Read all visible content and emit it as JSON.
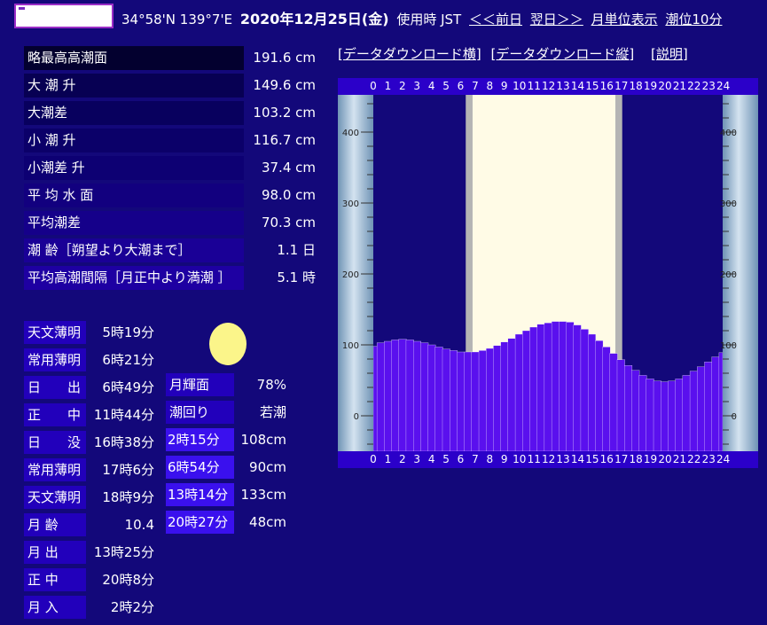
{
  "header": {
    "location": "34°58'N 139°7'E",
    "date": "2020年12月25日(金)",
    "timezone": "使用時 JST",
    "prev_day": "＜＜前日",
    "next_day": "翌日＞＞",
    "monthly": "月単位表示",
    "ten_min": "潮位10分"
  },
  "stats": [
    {
      "label": "略最高高潮面",
      "value": "191.6 cm"
    },
    {
      "label": "大 潮 升",
      "value": "149.6 cm"
    },
    {
      "label": "大潮差",
      "value": "103.2 cm"
    },
    {
      "label": "小 潮 升",
      "value": "116.7 cm"
    },
    {
      "label": "小潮差 升",
      "value": "37.4 cm"
    },
    {
      "label": "平 均 水 面",
      "value": "98.0 cm"
    },
    {
      "label": "平均潮差",
      "value": "70.3 cm"
    },
    {
      "label": "潮 齢［朔望より大潮まで］",
      "value": "1.1 日"
    },
    {
      "label": "平均高潮間隔［月正中より満潮 ］",
      "value": "5.1 時"
    }
  ],
  "sun_moon": [
    {
      "label": "天文薄明",
      "value": "5時19分"
    },
    {
      "label": "常用薄明",
      "value": "6時21分"
    },
    {
      "label": "日　　出",
      "value": "6時49分"
    },
    {
      "label": "正　　中",
      "value": "11時44分"
    },
    {
      "label": "日　　没",
      "value": "16時38分"
    },
    {
      "label": "常用薄明",
      "value": "17時6分"
    },
    {
      "label": "天文薄明",
      "value": "18時9分"
    },
    {
      "label": "月 齢",
      "value": "10.4"
    },
    {
      "label": "月 出",
      "value": "13時25分"
    },
    {
      "label": "正 中",
      "value": "20時8分"
    },
    {
      "label": "月 入",
      "value": "2時2分"
    }
  ],
  "moon_info": [
    {
      "label": "月輝面",
      "value": "78%"
    },
    {
      "label": "潮回り",
      "value": "若潮"
    }
  ],
  "tides": [
    {
      "time": "2時15分",
      "level": "108cm"
    },
    {
      "time": "6時54分",
      "level": "90cm"
    },
    {
      "time": "13時14分",
      "level": "133cm"
    },
    {
      "time": "20時27分",
      "level": "48cm"
    }
  ],
  "links": {
    "download_h": "[データダウンロード横]",
    "download_v": "[データダウンロード縦]",
    "explain": "[説明]"
  },
  "colors": {
    "background": "#13087a",
    "tide_fill": "#5a10ee",
    "daylight": "#fffbe6",
    "twilight": "#b4b4b4",
    "moon": "#fbf58a"
  },
  "chart_data": {
    "type": "area",
    "x": [
      0,
      0.5,
      1,
      1.5,
      2,
      2.5,
      3,
      3.5,
      4,
      4.5,
      5,
      5.5,
      6,
      6.5,
      7,
      7.5,
      8,
      8.5,
      9,
      9.5,
      10,
      10.5,
      11,
      11.5,
      12,
      12.5,
      13,
      13.5,
      14,
      14.5,
      15,
      15.5,
      16,
      16.5,
      17,
      17.5,
      18,
      18.5,
      19,
      19.5,
      20,
      20.5,
      21,
      21.5,
      22,
      22.5,
      23,
      23.5,
      24
    ],
    "values": [
      98,
      103,
      105,
      107,
      108,
      107,
      105,
      103,
      100,
      97,
      94,
      92,
      90,
      90,
      90,
      92,
      95,
      99,
      104,
      109,
      115,
      120,
      125,
      129,
      131,
      133,
      133,
      132,
      128,
      122,
      115,
      106,
      97,
      88,
      79,
      71,
      64,
      57,
      52,
      49,
      48,
      49,
      52,
      57,
      63,
      69,
      76,
      83,
      89
    ],
    "x_ticks": [
      "0",
      "1",
      "2",
      "3",
      "4",
      "5",
      "6",
      "7",
      "8",
      "9",
      "10",
      "11",
      "12",
      "13",
      "14",
      "15",
      "16",
      "17",
      "18",
      "19",
      "20",
      "21",
      "22",
      "23",
      "24"
    ],
    "y_ticks": [
      "0",
      "100",
      "200",
      "300",
      "400"
    ],
    "xlim": [
      0,
      24
    ],
    "ylim": [
      -50,
      500
    ],
    "daylight": [
      6.82,
      16.63
    ],
    "civil_twilight": [
      6.35,
      17.1
    ]
  }
}
